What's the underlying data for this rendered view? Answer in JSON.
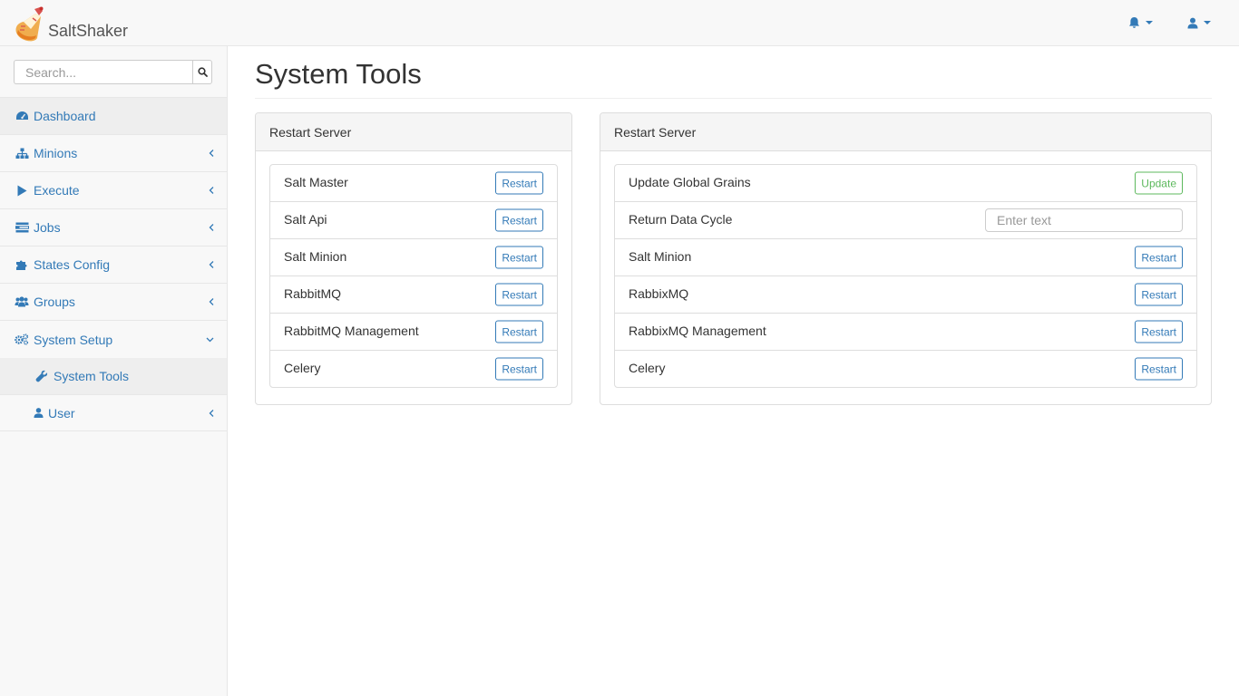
{
  "app": {
    "brand": "SaltShaker"
  },
  "navbar": {
    "notifications_icon": "bell-icon",
    "user_icon": "user-icon"
  },
  "sidebar": {
    "search": {
      "placeholder": "Search..."
    },
    "items": [
      {
        "label": "Dashboard",
        "icon": "dashboard-icon",
        "active": true
      },
      {
        "label": "Minions",
        "icon": "sitemap-icon"
      },
      {
        "label": "Execute",
        "icon": "play-icon"
      },
      {
        "label": "Jobs",
        "icon": "tasks-icon"
      },
      {
        "label": "States Config",
        "icon": "puzzle-icon"
      },
      {
        "label": "Groups",
        "icon": "users-icon"
      },
      {
        "label": "System Setup",
        "icon": "cogs-icon",
        "expanded": true,
        "children": [
          {
            "label": "System Tools",
            "icon": "wrench-icon"
          }
        ]
      },
      {
        "label": "User",
        "icon": "user-icon"
      }
    ]
  },
  "main": {
    "title": "System Tools",
    "panels": [
      {
        "heading": "Restart Server",
        "rows": [
          {
            "name": "Salt Master",
            "action": "Restart"
          },
          {
            "name": "Salt Api",
            "action": "Restart"
          },
          {
            "name": "Salt Minion",
            "action": "Restart"
          },
          {
            "name": "RabbitMQ",
            "action": "Restart"
          },
          {
            "name": "RabbitMQ Management",
            "action": "Restart"
          },
          {
            "name": "Celery",
            "action": "Restart"
          }
        ]
      },
      {
        "heading": "Restart Server",
        "rows": [
          {
            "name": "Update Global Grains",
            "action": "Update"
          },
          {
            "name": "Return Data Cycle",
            "input_placeholder": "Enter text",
            "input_value": ""
          },
          {
            "name": "Salt Minion",
            "action": "Restart"
          },
          {
            "name": "RabbixMQ",
            "action": "Restart"
          },
          {
            "name": "RabbixMQ Management",
            "action": "Restart"
          },
          {
            "name": "Celery",
            "action": "Restart"
          }
        ]
      }
    ]
  },
  "colors": {
    "link": "#337ab7",
    "success": "#5cb85c",
    "sidebar_bg": "#f8f8f8",
    "active_bg": "#eeeeee"
  }
}
